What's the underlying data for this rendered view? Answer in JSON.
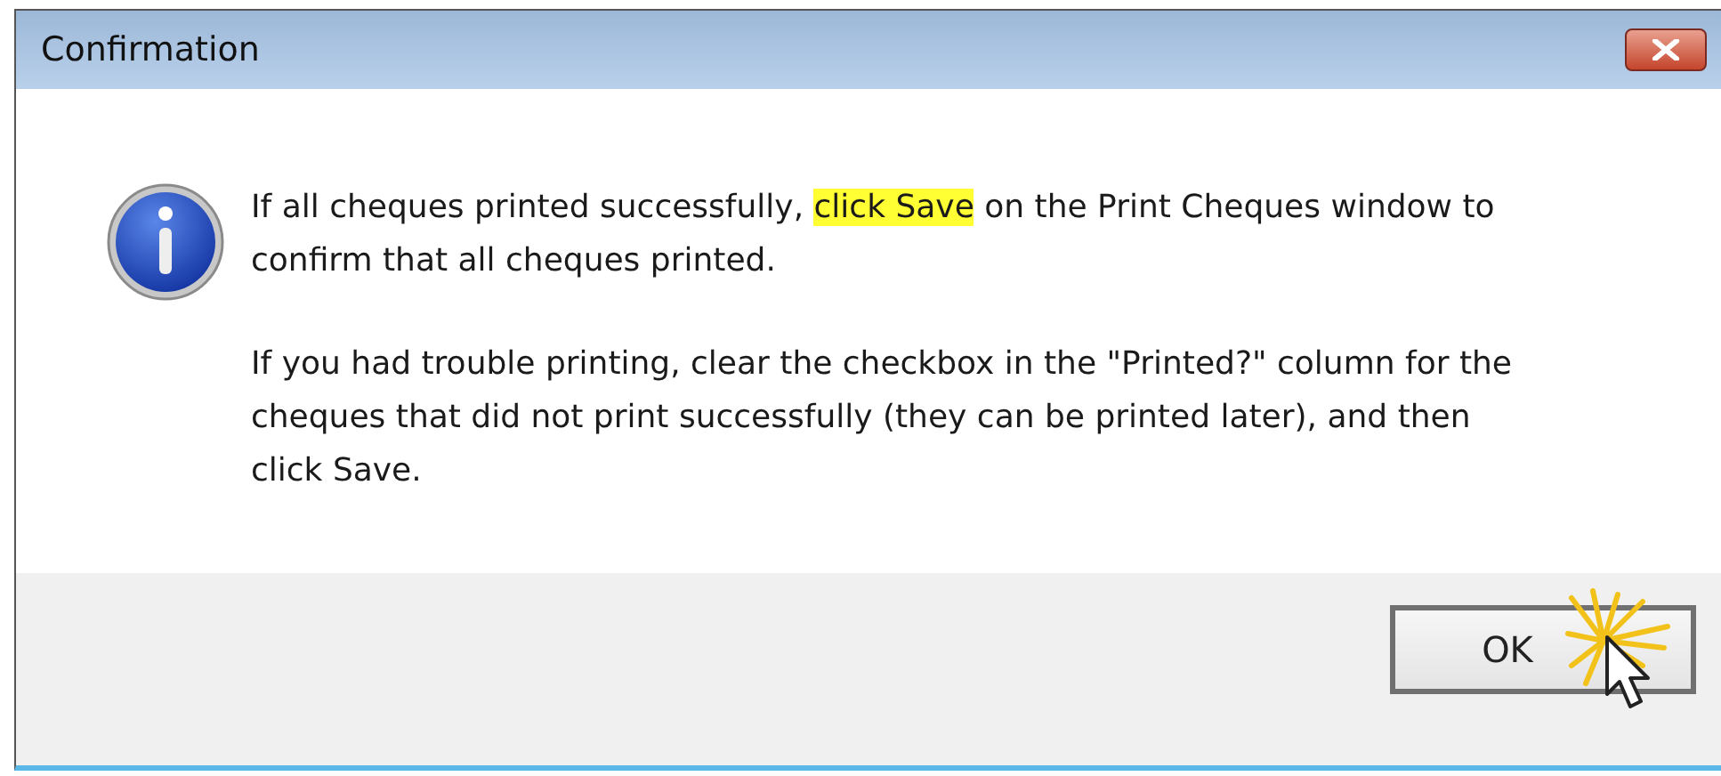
{
  "window": {
    "title": "Confirmation"
  },
  "message": {
    "paragraphs": [
      {
        "before": "If all cheques printed successfully, ",
        "highlight": "click Save",
        "after": " on the Print Cheques window to confirm that all cheques printed."
      },
      {
        "before": "If you had trouble printing, clear the checkbox in the \"Printed?\" column for the cheques that did not print successfully (they can be printed later), and then click Save."
      }
    ]
  },
  "buttons": [
    {
      "label": "OK"
    }
  ]
}
